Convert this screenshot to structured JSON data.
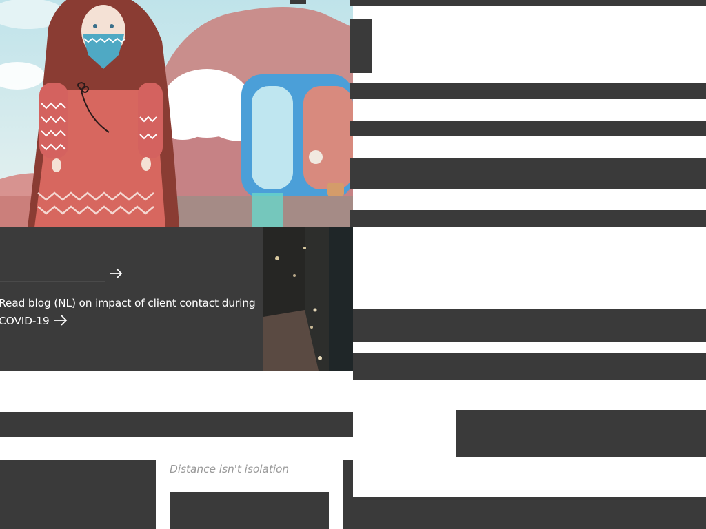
{
  "promo": {
    "blog_text": "Read blog (NL) on impact of client contact during COVID-19",
    "arrow_icon": "arrow-right-icon"
  },
  "article": {
    "tagline": "Distance isn't isolation"
  },
  "colors": {
    "dark_bar": "#3a3a3a",
    "promo_bg": "#3b3b3b",
    "text_light": "#ffffff",
    "tagline": "#9a9a9a"
  },
  "hero": {
    "image": "illustration of a long-haired girl with a face mask and a window with a masked figure"
  }
}
